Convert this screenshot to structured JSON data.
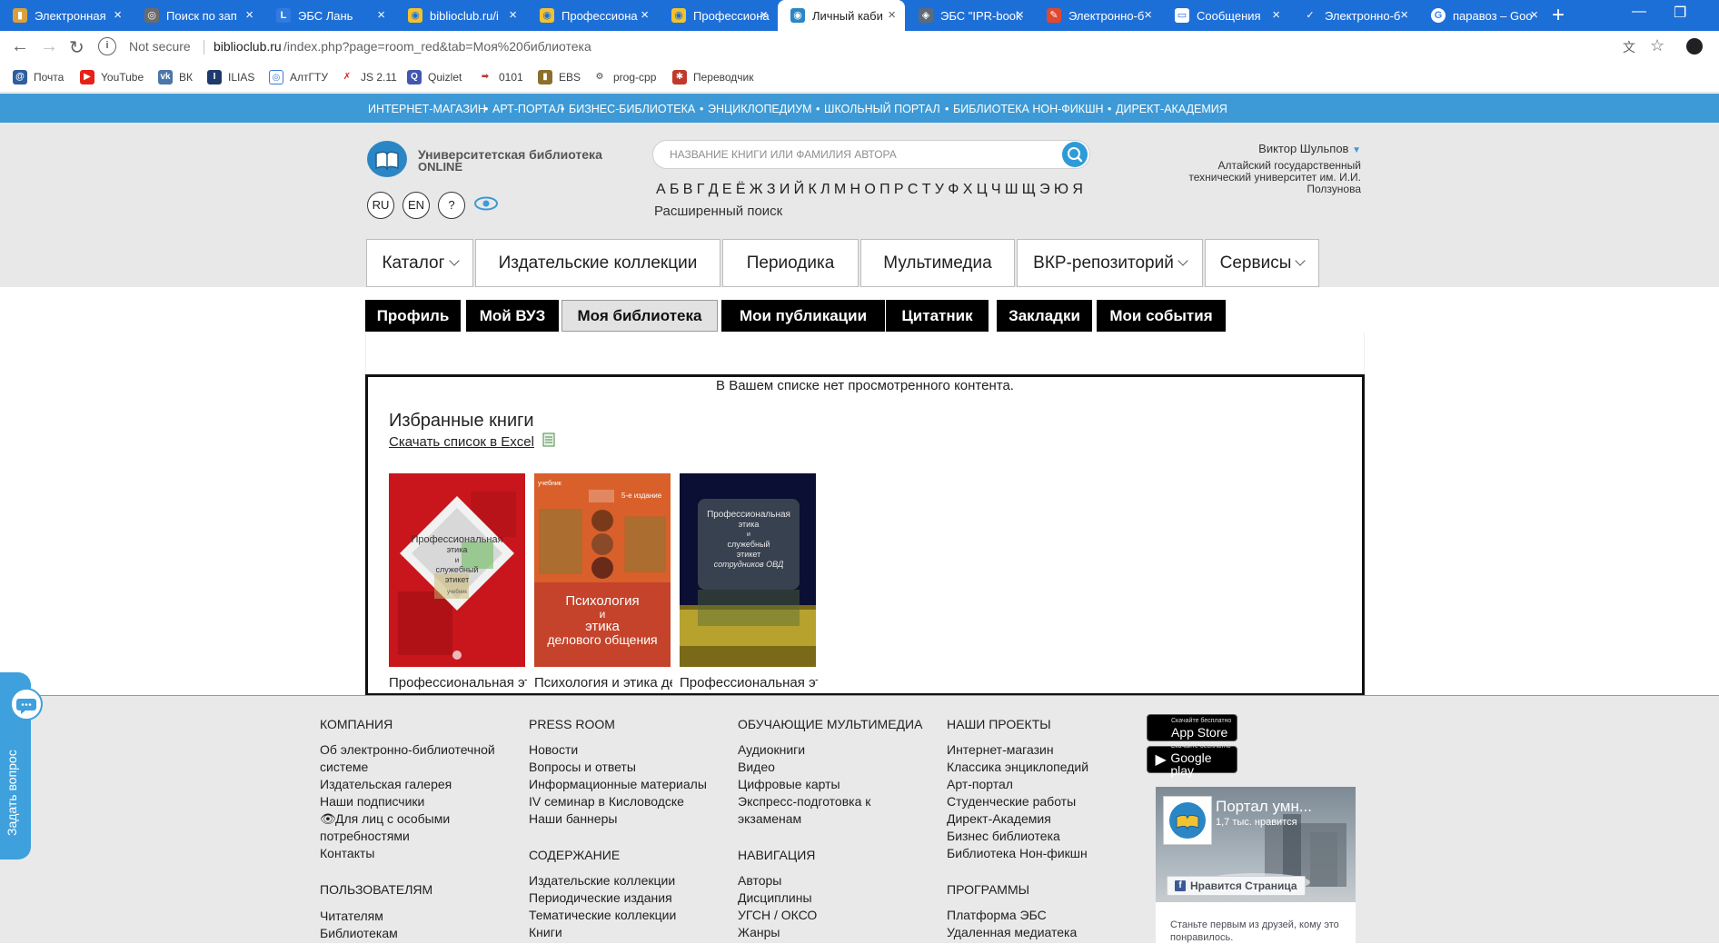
{
  "browser": {
    "tabs": [
      {
        "label": "Электронная"
      },
      {
        "label": "Поиск по зап"
      },
      {
        "label": "ЭБС Лань"
      },
      {
        "label": "biblioclub.ru/i"
      },
      {
        "label": "Профессиона"
      },
      {
        "label": "Профессиона"
      },
      {
        "label": "Личный каби"
      },
      {
        "label": "ЭБС \"IPR-book"
      },
      {
        "label": "Электронно-б"
      },
      {
        "label": "Сообщения"
      },
      {
        "label": "Электронно-б"
      },
      {
        "label": "паравоз – Goo"
      }
    ],
    "new_tab": "+",
    "url": {
      "security": "Not secure",
      "host": "biblioclub.ru",
      "path": "/index.php?page=room_red&tab=Моя%20библиотека"
    },
    "bookmarks": [
      {
        "label": "Почта",
        "color": "#2d5e9e"
      },
      {
        "label": "YouTube",
        "color": "#e62117"
      },
      {
        "label": "ВК",
        "color": "#4a76a8"
      },
      {
        "label": "ILIAS",
        "color": "#1e3a6b"
      },
      {
        "label": "АлтГТУ",
        "color": "#3a7bd5"
      },
      {
        "label": "JS 2.11",
        "color": "#d62828"
      },
      {
        "label": "Quizlet",
        "color": "#4257b2"
      },
      {
        "label": "0101",
        "color": "#c0392b"
      },
      {
        "label": "EBS",
        "color": "#8b6f2a"
      },
      {
        "label": "prog-cpp",
        "color": "#444444"
      },
      {
        "label": "Переводчик",
        "color": "#c0392b"
      }
    ]
  },
  "site": {
    "top_links": [
      "ИНТЕРНЕТ-МАГАЗИН",
      "АРТ-ПОРТАЛ",
      "БИЗНЕС-БИБЛИОТЕКА",
      "ЭНЦИКЛОПЕДИУМ",
      "ШКОЛЬНЫЙ ПОРТАЛ",
      "БИБЛИОТЕКА НОН-ФИКШН",
      "ДИРЕКТ-АКАДЕМИЯ"
    ],
    "logo": {
      "line1": "Университетская библиотека",
      "line2": "ONLINE"
    },
    "lang": [
      "RU",
      "EN",
      "?"
    ],
    "search_placeholder": "НАЗВАНИЕ КНИГИ ИЛИ ФАМИЛИЯ АВТОРА",
    "alphabet": [
      "А",
      "Б",
      "В",
      "Г",
      "Д",
      "Е",
      "Ё",
      "Ж",
      "З",
      "И",
      "Й",
      "К",
      "Л",
      "М",
      "Н",
      "О",
      "П",
      "Р",
      "С",
      "Т",
      "У",
      "Ф",
      "Х",
      "Ц",
      "Ч",
      "Ш",
      "Щ",
      "Э",
      "Ю",
      "Я"
    ],
    "advanced_search": "Расширенный поиск",
    "user": {
      "name": "Виктор Шульпов",
      "org_line1": "Алтайский государственный",
      "org_line2": "технический университет им. И.И.",
      "org_line3": "Ползунова"
    },
    "main_nav": [
      "Каталог",
      "Издательские коллекции",
      "Периодика",
      "Мультимедиа",
      "ВКР-репозиторий",
      "Сервисы"
    ],
    "sub_tabs": [
      "Профиль",
      "Мой ВУЗ",
      "Моя библиотека",
      "Мои публикации",
      "Цитатник",
      "Закладки",
      "Мои события"
    ],
    "active_sub_tab": "Моя библиотека",
    "content": {
      "empty_message": "В Вашем списке нет просмотренного контента.",
      "favorites_title": "Избранные книги",
      "excel_link": "Скачать список в Excel",
      "books": [
        {
          "title": "Профессиональная этика и служебный этикет",
          "cover_text": [
            "Профессиональная",
            "этика",
            "и",
            "служебный",
            "этикет",
            "учебник"
          ]
        },
        {
          "title": "Психология и этика делового общения",
          "cover_text": [
            "учебник",
            "5-е издание",
            "Психология",
            "и",
            "этика",
            "делового общения"
          ]
        },
        {
          "title": "Профессиональная этика и служебный этикет сотрудников ОВД",
          "cover_text": [
            "Профессиональная",
            "этика",
            "и",
            "служебный",
            "этикет",
            "сотрудников ОВД"
          ]
        }
      ]
    }
  },
  "footer": {
    "columns": [
      {
        "heading": "КОМПАНИЯ",
        "links": [
          "Об электронно-библиотечной",
          "системе",
          "Издательская галерея",
          "Наши подписчики",
          "Для лиц с особыми",
          "потребностями",
          "Контакты"
        ]
      },
      {
        "heading": "PRESS ROOM",
        "links": [
          "Новости",
          "Вопросы и ответы",
          "Информационные материалы",
          "IV семинар в Кисловодске",
          "Наши баннеры"
        ]
      },
      {
        "heading": "ОБУЧАЮЩИЕ МУЛЬТИМЕДИА",
        "links": [
          "Аудиокниги",
          "Видео",
          "Цифровые карты",
          "Экспресс-подготовка к",
          "экзаменам"
        ]
      },
      {
        "heading": "НАШИ ПРОЕКТЫ",
        "links": [
          "Интернет-магазин",
          "Классика энциклопедий",
          "Арт-портал",
          "Студенческие работы",
          "Директ-Академия",
          "Бизнес библиотека",
          "Библиотека Нон-фикшн"
        ]
      },
      {
        "heading": "ПОЛЬЗОВАТЕЛЯМ",
        "links": [
          "Читателям",
          "Библиотекам"
        ]
      },
      {
        "heading": "СОДЕРЖАНИЕ",
        "links": [
          "Издательские коллекции",
          "Периодические издания",
          "Тематические коллекции",
          "Книги"
        ]
      },
      {
        "heading": "НАВИГАЦИЯ",
        "links": [
          "Авторы",
          "Дисциплины",
          "УГСН / ОКСО",
          "Жанры"
        ]
      },
      {
        "heading": "ПРОГРАММЫ",
        "links": [
          "Платформа ЭБС",
          "Удаленная медиатека"
        ]
      }
    ],
    "stores": [
      {
        "small": "Скачайте бесплатно",
        "big": "App Store"
      },
      {
        "small": "Скачайте бесплатно",
        "big": "Google play"
      }
    ],
    "fb": {
      "name": "Портал умн...",
      "likes": "1,7 тыс. нравится",
      "like_button": "Нравится Страница",
      "friends_text": "Станьте первым из друзей, кому это понравилось."
    },
    "ask_question": "Задать вопрос"
  },
  "colors": {
    "browser_accent": "#1d6fd8",
    "site_blue": "#3d9ad6",
    "header_gray": "#e8e8e8",
    "subtab_black": "#000000"
  }
}
